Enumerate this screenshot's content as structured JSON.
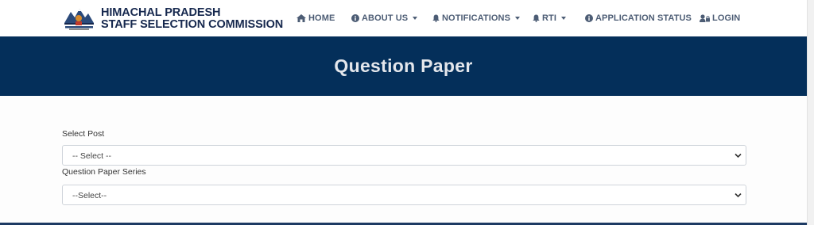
{
  "header": {
    "brand_line1": "HIMACHAL PRADESH",
    "brand_line2": "STAFF SELECTION COMMISSION"
  },
  "nav": {
    "home": "HOME",
    "about": "ABOUT US",
    "notifications": "NOTIFICATIONS",
    "rti": "RTI",
    "status": "APPLICATION STATUS",
    "login": "LOGIN"
  },
  "banner": {
    "title": "Question Paper"
  },
  "form": {
    "post_label": "Select Post",
    "post_value": "-- Select --",
    "series_label": "Question Paper Series",
    "series_value": "--Select--"
  },
  "colors": {
    "banner_bg": "#042f5a",
    "brand_text": "#16284e",
    "nav_text": "#4d5d75"
  }
}
